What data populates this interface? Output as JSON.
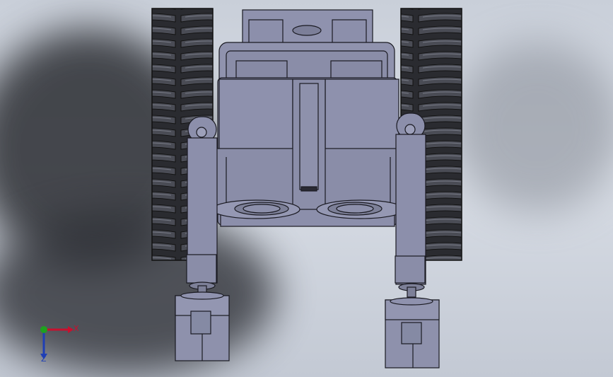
{
  "viewport": {
    "background_top": "#c9cfd9",
    "background_bottom": "#c3c9d4",
    "model_color": "#8c8fab",
    "edge_color": "#1a1a22"
  },
  "triad": {
    "x_label": "X",
    "z_label": "Z",
    "x_color": "#c8102e",
    "y_color": "#1fa11f",
    "z_color": "#1f3fb5"
  }
}
